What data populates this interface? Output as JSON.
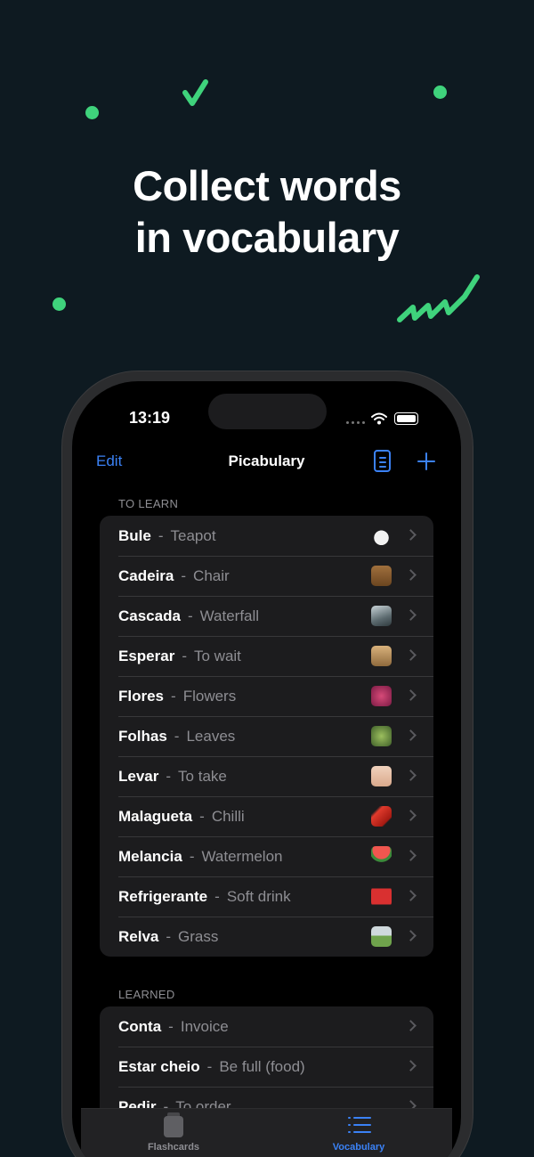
{
  "headline": {
    "line1": "Collect words",
    "line2": "in vocabulary"
  },
  "colors": {
    "accent": "#3b82f6",
    "decor_green": "#3fd37c",
    "background": "#0e1a21"
  },
  "status_bar": {
    "time": "13:19"
  },
  "nav": {
    "edit_label": "Edit",
    "title": "Picabulary",
    "book_icon": "book-icon",
    "add_icon": "plus-icon"
  },
  "sections": {
    "to_learn": {
      "header": "TO LEARN",
      "items": [
        {
          "word": "Bule",
          "meaning": "Teapot",
          "thumb": "teapot"
        },
        {
          "word": "Cadeira",
          "meaning": "Chair",
          "thumb": "chair"
        },
        {
          "word": "Cascada",
          "meaning": "Waterfall",
          "thumb": "waterfall"
        },
        {
          "word": "Esperar",
          "meaning": "To wait",
          "thumb": "hourglass"
        },
        {
          "word": "Flores",
          "meaning": "Flowers",
          "thumb": "flowers"
        },
        {
          "word": "Folhas",
          "meaning": "Leaves",
          "thumb": "leaves"
        },
        {
          "word": "Levar",
          "meaning": "To take",
          "thumb": "hand"
        },
        {
          "word": "Malagueta",
          "meaning": "Chilli",
          "thumb": "chilli"
        },
        {
          "word": "Melancia",
          "meaning": "Watermelon",
          "thumb": "watermelon"
        },
        {
          "word": "Refrigerante",
          "meaning": "Soft drink",
          "thumb": "soft-drink"
        },
        {
          "word": "Relva",
          "meaning": "Grass",
          "thumb": "grass"
        }
      ]
    },
    "learned": {
      "header": "LEARNED",
      "items": [
        {
          "word": "Conta",
          "meaning": "Invoice"
        },
        {
          "word": "Estar cheio",
          "meaning": "Be full (food)"
        },
        {
          "word": "Pedir",
          "meaning": "To order"
        }
      ]
    }
  },
  "tabbar": {
    "tabs": [
      {
        "label": "Flashcards",
        "icon": "cards-icon",
        "active": false
      },
      {
        "label": "Vocabulary",
        "icon": "list-icon",
        "active": true
      }
    ]
  }
}
